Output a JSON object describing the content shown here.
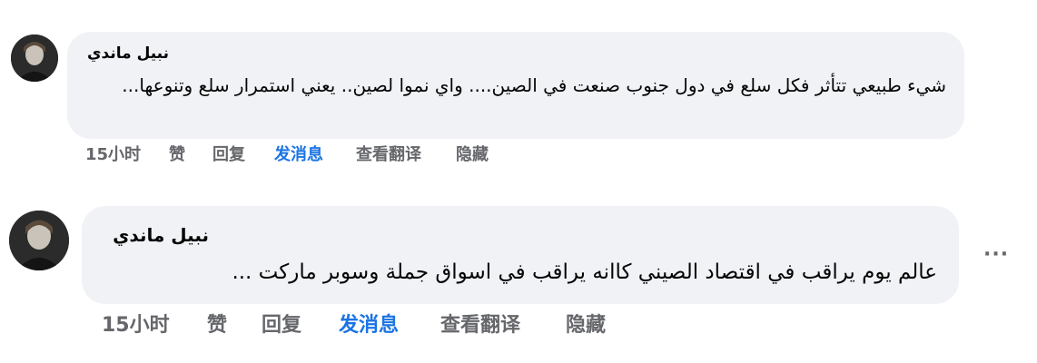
{
  "comments": [
    {
      "author": "نبيل ماندي",
      "text": "شيء طبيعي تتأثر فكل سلع في دول جنوب صنعت في الصين.... واي نموا لصين.. يعني استمرار سلع وتنوعها...",
      "actions": {
        "time": "15小时",
        "like": "赞",
        "reply": "回复",
        "message": "发消息",
        "translate": "查看翻译",
        "hide": "隐藏"
      }
    },
    {
      "author": "نبيل ماندي",
      "text": "عالم يوم يراقب في اقتصاد الصيني كاانه يراقب في اسواق جملة وسوبر ماركت ...",
      "actions": {
        "time": "15小时",
        "like": "赞",
        "reply": "回复",
        "message": "发消息",
        "translate": "查看翻译",
        "hide": "隐藏"
      },
      "more_label": "···"
    }
  ],
  "colors": {
    "bubble": "#f0f2f5",
    "action_text": "#65676b",
    "message_link": "#1b74e4"
  }
}
